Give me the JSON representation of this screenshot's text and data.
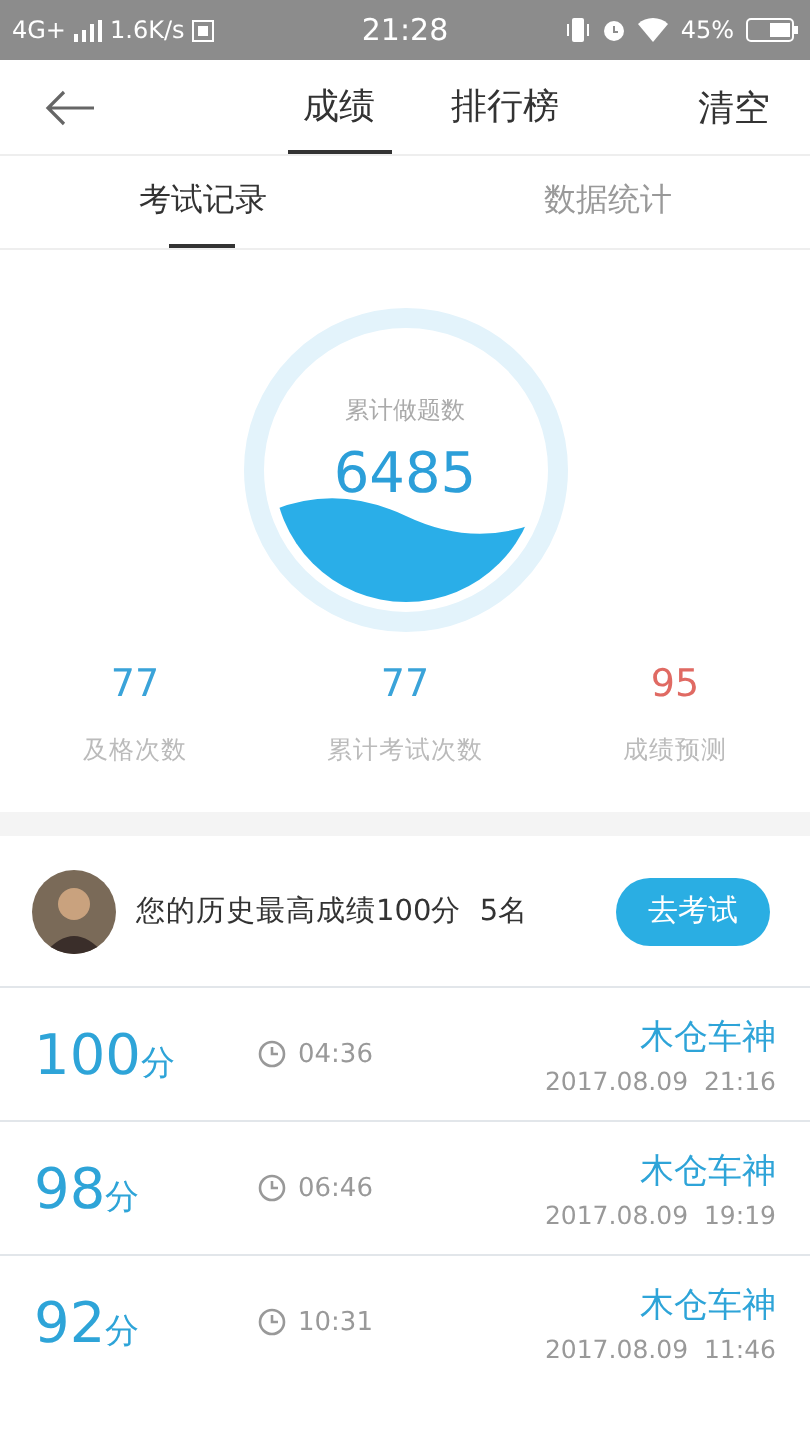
{
  "status_bar": {
    "network": "4G+",
    "speed": "1.6K/s",
    "time": "21:28",
    "battery": "45%"
  },
  "header": {
    "tabs": [
      {
        "label": "成绩",
        "selected": true
      },
      {
        "label": "排行榜",
        "selected": false
      }
    ],
    "action": "清空"
  },
  "subtabs": [
    {
      "label": "考试记录",
      "selected": true
    },
    {
      "label": "数据统计",
      "selected": false
    }
  ],
  "gauge": {
    "label": "累计做题数",
    "value": "6485"
  },
  "stats": [
    {
      "value": "77",
      "label": "及格次数",
      "color": "#3aa3d9"
    },
    {
      "value": "77",
      "label": "累计考试次数",
      "color": "#3aa3d9"
    },
    {
      "value": "95",
      "label": "成绩预测",
      "color": "#e06a63"
    }
  ],
  "best": {
    "text": "您的历史最高成绩100分  5名",
    "button": "去考试"
  },
  "records": [
    {
      "score": "100",
      "unit": "分",
      "duration": "04:36",
      "name": "木仓车神",
      "date": "2017.08.09  21:16"
    },
    {
      "score": "98",
      "unit": "分",
      "duration": "06:46",
      "name": "木仓车神",
      "date": "2017.08.09  19:19"
    },
    {
      "score": "92",
      "unit": "分",
      "duration": "10:31",
      "name": "木仓车神",
      "date": "2017.08.09  11:46"
    }
  ]
}
